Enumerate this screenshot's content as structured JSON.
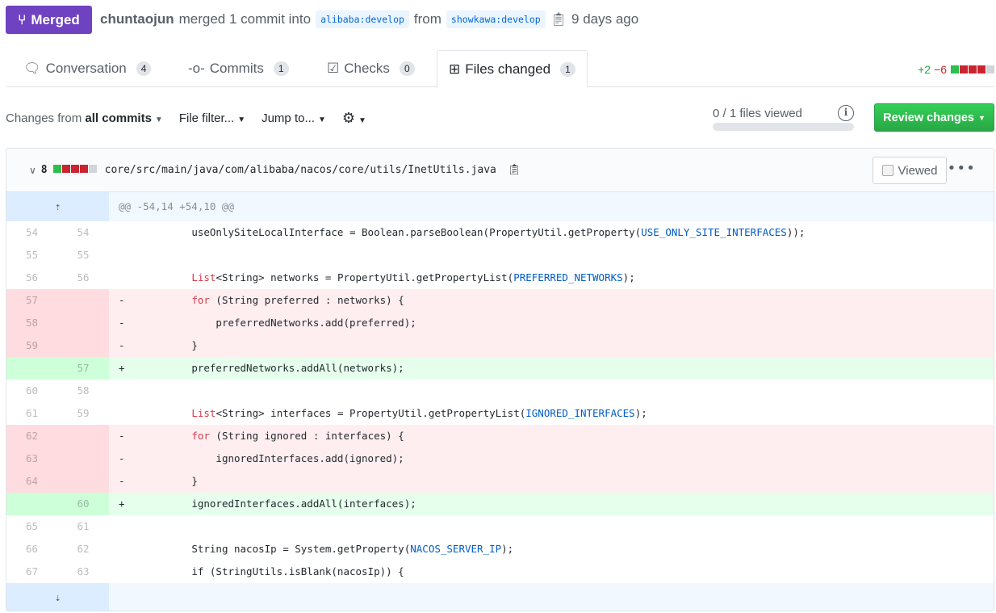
{
  "header": {
    "status": "Merged",
    "author": "chuntaojun",
    "action": "merged 1 commit into",
    "base": "alibaba:develop",
    "from": "from",
    "head": "showkawa:develop",
    "time": "9 days ago"
  },
  "tabs": [
    {
      "label": "Conversation",
      "count": "4",
      "icon": "comment-discussion-icon"
    },
    {
      "label": "Commits",
      "count": "1",
      "icon": "git-commit-icon"
    },
    {
      "label": "Checks",
      "count": "0",
      "icon": "checklist-icon"
    },
    {
      "label": "Files changed",
      "count": "1",
      "icon": "diff-icon",
      "selected": true
    }
  ],
  "diffstat": {
    "additions": "+2",
    "deletions": "−6",
    "blocks": [
      "add",
      "del",
      "del",
      "del",
      "neutral"
    ]
  },
  "toolbar": {
    "changes_prefix": "Changes from",
    "changes_value": "all commits",
    "file_filter": "File filter...",
    "jump_to": "Jump to...",
    "files_viewed": "0 / 1 files viewed",
    "files_viewed_progress": 0,
    "review_button": "Review changes"
  },
  "colors": {
    "merged": "#6f42c1",
    "add": "#2cbe4e",
    "del": "#cb2431",
    "neutral": "#d1d5da",
    "review": "#28a745"
  },
  "file": {
    "changes": "8",
    "path": "core/src/main/java/com/alibaba/nacos/core/utils/InetUtils.java",
    "viewed_label": "Viewed",
    "viewed": false,
    "hunk": "@@ -54,14 +54,10 @@",
    "lines": [
      {
        "type": "ctx",
        "old": "54",
        "new": "54",
        "parts": [
          [
            "        useOnlySiteLocalInterface = Boolean.parseBoolean(PropertyUtil.getProperty(",
            ""
          ],
          [
            "USE_ONLY_SITE_INTERFACES",
            "cst"
          ],
          [
            "));",
            ""
          ]
        ]
      },
      {
        "type": "ctx",
        "old": "55",
        "new": "55",
        "parts": []
      },
      {
        "type": "ctx",
        "old": "56",
        "new": "56",
        "parts": [
          [
            "        ",
            ""
          ],
          [
            "List",
            "kw"
          ],
          [
            "<String> networks = PropertyUtil.getPropertyList(",
            ""
          ],
          [
            "PREFERRED_NETWORKS",
            "cst"
          ],
          [
            ");",
            ""
          ]
        ]
      },
      {
        "type": "del",
        "old": "57",
        "new": "",
        "parts": [
          [
            "        ",
            ""
          ],
          [
            "for",
            "kw"
          ],
          [
            " (String preferred : networks) {",
            ""
          ]
        ]
      },
      {
        "type": "del",
        "old": "58",
        "new": "",
        "parts": [
          [
            "            preferredNetworks.add(preferred);",
            ""
          ]
        ]
      },
      {
        "type": "del",
        "old": "59",
        "new": "",
        "parts": [
          [
            "        }",
            ""
          ]
        ]
      },
      {
        "type": "add",
        "old": "",
        "new": "57",
        "parts": [
          [
            "        preferredNetworks.addAll(networks);",
            ""
          ]
        ]
      },
      {
        "type": "ctx",
        "old": "60",
        "new": "58",
        "parts": []
      },
      {
        "type": "ctx",
        "old": "61",
        "new": "59",
        "parts": [
          [
            "        ",
            ""
          ],
          [
            "List",
            "kw"
          ],
          [
            "<String> interfaces = PropertyUtil.getPropertyList(",
            ""
          ],
          [
            "IGNORED_INTERFACES",
            "cst"
          ],
          [
            ");",
            ""
          ]
        ]
      },
      {
        "type": "del",
        "old": "62",
        "new": "",
        "parts": [
          [
            "        ",
            ""
          ],
          [
            "for",
            "kw"
          ],
          [
            " (String ignored : interfaces) {",
            ""
          ]
        ]
      },
      {
        "type": "del",
        "old": "63",
        "new": "",
        "parts": [
          [
            "            ignoredInterfaces.add(ignored);",
            ""
          ]
        ]
      },
      {
        "type": "del",
        "old": "64",
        "new": "",
        "parts": [
          [
            "        }",
            ""
          ]
        ]
      },
      {
        "type": "add",
        "old": "",
        "new": "60",
        "parts": [
          [
            "        ignoredInterfaces.addAll(interfaces);",
            ""
          ]
        ]
      },
      {
        "type": "ctx",
        "old": "65",
        "new": "61",
        "parts": []
      },
      {
        "type": "ctx",
        "old": "66",
        "new": "62",
        "parts": [
          [
            "        String nacosIp = System.getProperty(",
            ""
          ],
          [
            "NACOS_SERVER_IP",
            "cst"
          ],
          [
            ");",
            ""
          ]
        ]
      },
      {
        "type": "ctx",
        "old": "67",
        "new": "63",
        "parts": [
          [
            "        if (StringUtils.isBlank(nacosIp)) {",
            ""
          ]
        ]
      }
    ]
  }
}
